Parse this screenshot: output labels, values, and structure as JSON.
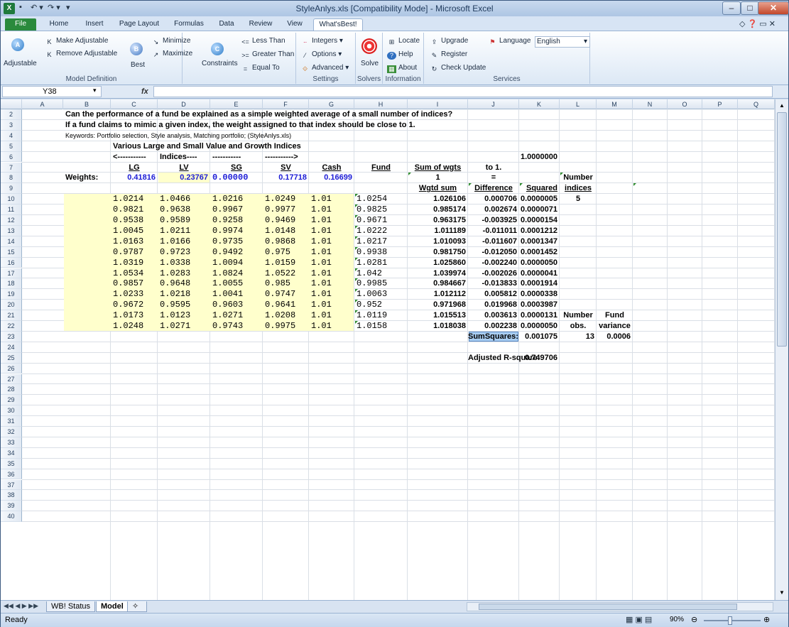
{
  "window": {
    "title": "StyleAnlys.xls  [Compatibility Mode]  -  Microsoft Excel",
    "app_icon": "excel-icon",
    "min": "–",
    "max": "□",
    "close": "✕"
  },
  "tabs": [
    "File",
    "Home",
    "Insert",
    "Page Layout",
    "Formulas",
    "Data",
    "Review",
    "View",
    "What'sBest!"
  ],
  "ribbon": {
    "adjustable": "Adjustable",
    "make_adjustable": "Make Adjustable",
    "remove_adjustable": "Remove Adjustable",
    "best": "Best",
    "minimize": "Minimize",
    "maximize": "Maximize",
    "constraints": "Constraints",
    "less_than": "Less Than",
    "greater_than": "Greater Than",
    "equal_to": "Equal To",
    "model_def_label": "Model Definition",
    "integers": "Integers",
    "options": "Options",
    "advanced": "Advanced",
    "settings_label": "Settings",
    "solve": "Solve",
    "solvers_label": "Solvers",
    "locate": "Locate",
    "help": "Help",
    "about": "About",
    "information_label": "Information",
    "upgrade": "Upgrade",
    "register": "Register",
    "check_update": "Check Update",
    "language": "Language",
    "language_value": "English",
    "services_label": "Services"
  },
  "formula_bar": {
    "name_box": "Y38",
    "fx": "fx",
    "value": ""
  },
  "columns": [
    "A",
    "B",
    "C",
    "D",
    "E",
    "F",
    "G",
    "H",
    "I",
    "J",
    "K",
    "L",
    "M",
    "N",
    "O",
    "P",
    "Q"
  ],
  "rows": [
    "2",
    "3",
    "4",
    "5",
    "6",
    "7",
    "8",
    "9",
    "10",
    "11",
    "12",
    "13",
    "14",
    "15",
    "16",
    "17",
    "18",
    "19",
    "20",
    "21",
    "22",
    "23",
    "24",
    "25",
    "26",
    "27",
    "28",
    "29",
    "30",
    "31",
    "32",
    "33",
    "34",
    "35",
    "36",
    "37",
    "38",
    "39",
    "40"
  ],
  "sheet": {
    "r2": "Can the performance of a fund be explained as a simple weighted average of a small number of indices?",
    "r3": "If a fund claims to mimic a given index, the weight assigned to that index should be close to 1.",
    "r4": "Keywords: Portfolio selection, Style analysis, Matching portfolio;     (StyleAnlys.xls)",
    "r5": "Various Large and Small Value and Growth Indices",
    "r6": {
      "b": "<-----------",
      "c": "Indices----",
      "d": "-----------",
      "e": "----------->",
      "j": "1.0000000"
    },
    "r7": {
      "b": "LG",
      "c": "LV",
      "d": "SG",
      "e": "SV",
      "f": "Cash",
      "g": "Fund",
      "h": "Sum of wgts",
      "i": "to 1."
    },
    "r8": {
      "a": "Weights:",
      "b": "0.41816",
      "c": "0.23767",
      "d": "0.00000",
      "e": "0.17718",
      "f": "0.16699",
      "h": "1",
      "i": "=",
      "k": "Number"
    },
    "r9": {
      "h": "Wgtd sum",
      "i": "Difference",
      "j": "Squared",
      "k": "indices"
    },
    "data": [
      [
        "1.0214",
        "1.0466",
        "1.0216",
        "1.0249",
        "1.01",
        "1.0254",
        "1.026106",
        "0.000706",
        "0.0000005"
      ],
      [
        "0.9821",
        "0.9638",
        "0.9967",
        "0.9977",
        "1.01",
        "0.9825",
        "0.985174",
        "0.002674",
        "0.0000071"
      ],
      [
        "0.9538",
        "0.9589",
        "0.9258",
        "0.9469",
        "1.01",
        "0.9671",
        "0.963175",
        "-0.003925",
        "0.0000154"
      ],
      [
        "1.0045",
        "1.0211",
        "0.9974",
        "1.0148",
        "1.01",
        "1.0222",
        "1.011189",
        "-0.011011",
        "0.0001212"
      ],
      [
        "1.0163",
        "1.0166",
        "0.9735",
        "0.9868",
        "1.01",
        "1.0217",
        "1.010093",
        "-0.011607",
        "0.0001347"
      ],
      [
        "0.9787",
        "0.9723",
        "0.9492",
        "0.975",
        "1.01",
        "0.9938",
        "0.981750",
        "-0.012050",
        "0.0001452"
      ],
      [
        "1.0319",
        "1.0338",
        "1.0094",
        "1.0159",
        "1.01",
        "1.0281",
        "1.025860",
        "-0.002240",
        "0.0000050"
      ],
      [
        "1.0534",
        "1.0283",
        "1.0824",
        "1.0522",
        "1.01",
        "1.042",
        "1.039974",
        "-0.002026",
        "0.0000041"
      ],
      [
        "0.9857",
        "0.9648",
        "1.0055",
        "0.985",
        "1.01",
        "0.9985",
        "0.984667",
        "-0.013833",
        "0.0001914"
      ],
      [
        "1.0233",
        "1.0218",
        "1.0041",
        "0.9747",
        "1.01",
        "1.0063",
        "1.012112",
        "0.005812",
        "0.0000338"
      ],
      [
        "0.9672",
        "0.9595",
        "0.9603",
        "0.9641",
        "1.01",
        "0.952",
        "0.971968",
        "0.019968",
        "0.0003987"
      ],
      [
        "1.0173",
        "1.0123",
        "1.0271",
        "1.0208",
        "1.01",
        "1.0119",
        "1.015513",
        "0.003613",
        "0.0000131"
      ],
      [
        "1.0248",
        "1.0271",
        "0.9743",
        "0.9975",
        "1.01",
        "1.0158",
        "1.018038",
        "0.002238",
        "0.0000050"
      ]
    ],
    "k10": "5",
    "k21": "Number",
    "l21": "Fund",
    "k22": "obs.",
    "l22": "variance",
    "i23": "SumSquares:",
    "j23": "0.001075",
    "k23": "13",
    "l23": "0.0006",
    "i25": "Adjusted R-square:",
    "j25": "0.749706"
  },
  "sheet_tabs": [
    "WB! Status",
    "Model"
  ],
  "status": {
    "ready": "Ready",
    "zoom": "90%"
  }
}
